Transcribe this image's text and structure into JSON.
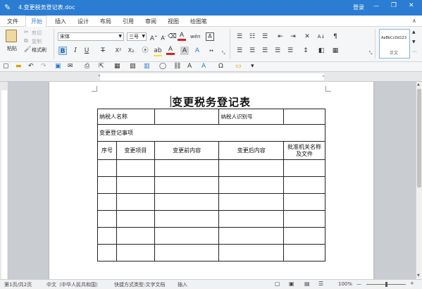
{
  "window": {
    "title": "4.变更税务登记表.doc",
    "login": "登录",
    "min": "—",
    "restore": "❐",
    "close": "✕"
  },
  "menu": {
    "file": "文件",
    "tabs": [
      "开始",
      "插入",
      "设计",
      "布局",
      "引用",
      "审阅",
      "视图",
      "绘图笔"
    ],
    "active_tab": "开始"
  },
  "clipboard": {
    "paste": "粘贴",
    "cut": "剪切",
    "copy": "复制",
    "format_painter": "格式刷"
  },
  "font": {
    "name": "宋体",
    "size": "三号"
  },
  "styles": {
    "preview": "AaBbCcDd123",
    "name": "正文"
  },
  "status": {
    "page": "第1页/共2页",
    "language": "中文（中华人民共和国）",
    "doctype": "快捷方式类型:文字文档",
    "mode": "插入",
    "zoom": "100%",
    "zoom_minus": "—",
    "zoom_plus": "+",
    "zoom_level": 0.5
  },
  "doc": {
    "title": "变更税务登记表",
    "taxpayer_name_label": "纳税人名称",
    "taxpayer_id_label": "纳税人识别号",
    "change_items_label": "变更登记事项",
    "headers": [
      "序号",
      "变更项目",
      "变更前内容",
      "变更后内容",
      "批准机关名称及文件"
    ]
  },
  "colors": {
    "accent": "#2b7cd3",
    "active_tab_text": "#2b7cd3",
    "font_color": "#e02020",
    "highlight": "#f7e51d"
  }
}
